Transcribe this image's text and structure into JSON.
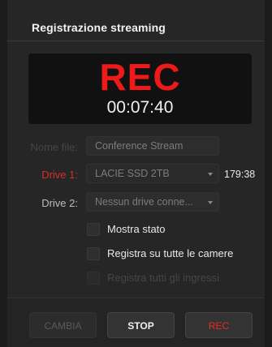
{
  "header": {
    "title": "Registrazione streaming"
  },
  "monitor": {
    "status": "REC",
    "timecode": "00:07:40"
  },
  "file_name": {
    "label": "Nome file:",
    "value": "Conference Stream"
  },
  "drive1": {
    "label": "Drive 1:",
    "value": "LACIE SSD 2TB",
    "remaining": "179:38"
  },
  "drive2": {
    "label": "Drive 2:",
    "value": "Nessun drive conne..."
  },
  "options": {
    "show_status": "Mostra stato",
    "record_all_cameras": "Registra su tutte le camere",
    "record_all_inputs": "Registra tutti gli ingressi"
  },
  "buttons": {
    "change": "CAMBIA",
    "stop": "STOP",
    "rec": "REC"
  },
  "colors": {
    "rec_red": "#ee1a1a",
    "drive1_label_red": "#d4302e",
    "background": "#262626"
  }
}
